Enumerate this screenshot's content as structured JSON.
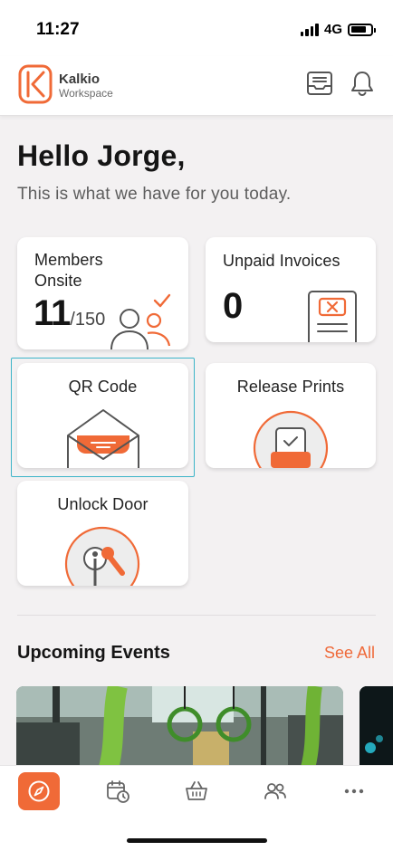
{
  "status_bar": {
    "time": "11:27",
    "network": "4G"
  },
  "header": {
    "brand_name": "Kalkio",
    "brand_sub": "Workspace",
    "icons": [
      "inbox-icon",
      "bell-icon"
    ]
  },
  "main": {
    "greeting": "Hello Jorge,",
    "subtext": "This is what we have for you today.",
    "cards": {
      "members": {
        "title": "Members Onsite",
        "count": "11",
        "capacity": "/150"
      },
      "invoices": {
        "title": "Unpaid Invoices",
        "count": "0"
      },
      "qr": {
        "title": "QR Code"
      },
      "prints": {
        "title": "Release Prints"
      },
      "unlock": {
        "title": "Unlock Door"
      }
    }
  },
  "events": {
    "title": "Upcoming Events",
    "see_all": "See All"
  },
  "tab_bar": {
    "tabs": [
      "compass-icon",
      "calendar-clock-icon",
      "basket-icon",
      "people-icon",
      "more-icon"
    ],
    "active_index": 0
  },
  "colors": {
    "accent": "#f06a37",
    "focus": "#3cb4c8",
    "background": "#f3f1f2"
  }
}
